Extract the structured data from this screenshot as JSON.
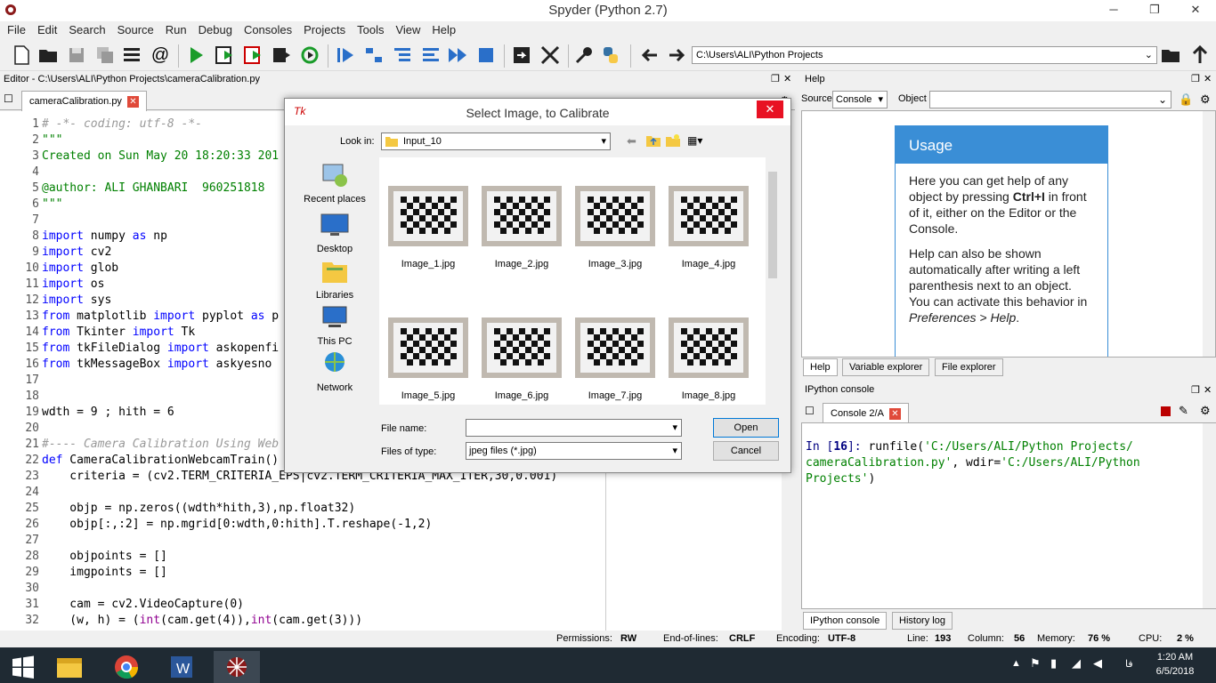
{
  "window": {
    "title": "Spyder (Python 2.7)",
    "minimize": "─",
    "maximize": "❐",
    "close": "✕"
  },
  "menu": [
    "File",
    "Edit",
    "Search",
    "Source",
    "Run",
    "Debug",
    "Consoles",
    "Projects",
    "Tools",
    "View",
    "Help"
  ],
  "toolbar": {
    "path": "C:\\Users\\ALI\\Python Projects"
  },
  "editor": {
    "header": "Editor - C:\\Users\\ALI\\Python Projects\\cameraCalibration.py",
    "tab": "cameraCalibration.py",
    "lines": [
      {
        "n": "1",
        "t": "# -*- coding: utf-8 -*-"
      },
      {
        "n": "2",
        "t": "\"\"\""
      },
      {
        "n": "3",
        "t": "Created on Sun May 20 18:20:33 201"
      },
      {
        "n": "4",
        "t": ""
      },
      {
        "n": "5",
        "t": "@author: ALI GHANBARI  960251818"
      },
      {
        "n": "6",
        "t": "\"\"\""
      },
      {
        "n": "7",
        "t": ""
      },
      {
        "n": "8",
        "t": "import numpy as np"
      },
      {
        "n": "9",
        "t": "import cv2"
      },
      {
        "n": "10",
        "t": "import glob"
      },
      {
        "n": "11",
        "t": "import os"
      },
      {
        "n": "12",
        "t": "import sys"
      },
      {
        "n": "13",
        "t": "from matplotlib import pyplot as p"
      },
      {
        "n": "14",
        "t": "from Tkinter import Tk"
      },
      {
        "n": "15",
        "t": "from tkFileDialog import askopenfi"
      },
      {
        "n": "16",
        "t": "from tkMessageBox import askyesno"
      },
      {
        "n": "17",
        "t": ""
      },
      {
        "n": "18",
        "t": ""
      },
      {
        "n": "19",
        "t": "wdth = 9 ; hith = 6"
      },
      {
        "n": "20",
        "t": ""
      },
      {
        "n": "21",
        "t": "#---- Camera Calibration Using Web"
      },
      {
        "n": "22",
        "t": "def CameraCalibrationWebcamTrain()"
      },
      {
        "n": "23",
        "t": "    criteria = (cv2.TERM_CRITERIA_EPS|cv2.TERM_CRITERIA_MAX_ITER,30,0.001)"
      },
      {
        "n": "24",
        "t": ""
      },
      {
        "n": "25",
        "t": "    objp = np.zeros((wdth*hith,3),np.float32)"
      },
      {
        "n": "26",
        "t": "    objp[:,:2] = np.mgrid[0:wdth,0:hith].T.reshape(-1,2)"
      },
      {
        "n": "27",
        "t": ""
      },
      {
        "n": "28",
        "t": "    objpoints = []"
      },
      {
        "n": "29",
        "t": "    imgpoints = []"
      },
      {
        "n": "30",
        "t": ""
      },
      {
        "n": "31",
        "t": "    cam = cv2.VideoCapture(0)"
      },
      {
        "n": "32",
        "t": "    (w, h) = (int(cam.get(4)),int(cam.get(3)))"
      }
    ]
  },
  "help": {
    "header": "Help",
    "source_label": "Source",
    "source_value": "Console",
    "object_label": "Object",
    "usage_title": "Usage",
    "usage_p1_a": "Here you can get help of any object by pressing ",
    "usage_p1_b": "Ctrl+I",
    "usage_p1_c": " in front of it, either on the Editor or the Console.",
    "usage_p2_a": "Help can also be shown automatically after writing a left parenthesis next to an object. You can activate this behavior in ",
    "usage_p2_b": "Preferences > Help",
    "usage_p2_c": ".",
    "tabs": [
      "Help",
      "Variable explorer",
      "File explorer"
    ]
  },
  "ipython": {
    "header": "IPython console",
    "tab": "Console 2/A",
    "prompt": "In [",
    "count": "16",
    "prompt_end": "]: ",
    "cmd1": "runfile(",
    "arg1": "'C:/Users/ALI/Python Projects/",
    "arg1b": "cameraCalibration.py'",
    "cmd2": ", wdir=",
    "arg2": "'C:/Users/ALI/Python",
    "arg2b": "Projects'",
    "cmd3": ")",
    "tabs": [
      "IPython console",
      "History log"
    ]
  },
  "status": {
    "permissions_label": "Permissions:",
    "permissions": "RW",
    "eol_label": "End-of-lines:",
    "eol": "CRLF",
    "encoding_label": "Encoding:",
    "encoding": "UTF-8",
    "line_label": "Line:",
    "line": "193",
    "column_label": "Column:",
    "column": "56",
    "memory_label": "Memory:",
    "memory": "76 %",
    "cpu_label": "CPU:",
    "cpu": "2 %"
  },
  "dialog": {
    "title": "Select Image, to Calibrate",
    "lookin_label": "Look in:",
    "lookin_value": "Input_10",
    "places": [
      "Recent places",
      "Desktop",
      "Libraries",
      "This PC",
      "Network"
    ],
    "files": [
      "Image_1.jpg",
      "Image_2.jpg",
      "Image_3.jpg",
      "Image_4.jpg",
      "Image_5.jpg",
      "Image_6.jpg",
      "Image_7.jpg",
      "Image_8.jpg"
    ],
    "filename_label": "File name:",
    "filename_value": "",
    "filetype_label": "Files of type:",
    "filetype_value": "jpeg files (*.jpg)",
    "open": "Open",
    "cancel": "Cancel"
  },
  "taskbar": {
    "time": "1:20 AM",
    "date": "6/5/2018",
    "lang": "فا"
  }
}
